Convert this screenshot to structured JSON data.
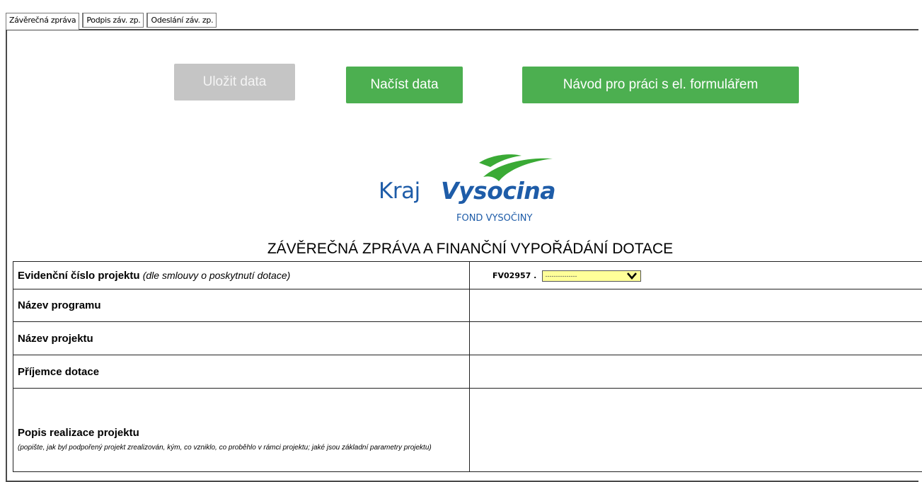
{
  "tabs": [
    {
      "label": "Závěrečná zpráva",
      "active": true
    },
    {
      "label": "Podpis záv. zp.",
      "active": false
    },
    {
      "label": "Odeslání záv. zp.",
      "active": false
    }
  ],
  "buttons": {
    "save": "Uložit data",
    "load": "Načíst data",
    "guide": "Návod pro práci s el. formulářem"
  },
  "logo": {
    "kraj": "Kraj",
    "vysocina": "Vysocina",
    "fond": "FOND VYSOČINY"
  },
  "document_title": "ZÁVĚREČNÁ ZPRÁVA A FINANČNÍ VYPOŘÁDÁNÍ DOTACE",
  "form": {
    "evidencni_label": "Evidenční číslo projektu",
    "evidencni_hint": "(dle smlouvy o poskytnutí dotace)",
    "evidencni_prefix": "FV02957 .",
    "evidencni_select_value": "---------------",
    "program_label": "Název programu",
    "projekt_label": "Název projektu",
    "prijemce_label": "Příjemce dotace",
    "popis_label": "Popis realizace projektu",
    "popis_hint": "(popište, jak byl podpořený projekt zrealizován, kým, co vzniklo, co proběhlo v rámci projektu; jaké jsou základní parametry projektu)"
  },
  "colors": {
    "accent_green": "#4caf50",
    "disabled_gray": "#c5c5c5",
    "logo_blue": "#1e5ca8",
    "logo_green": "#3aaa35",
    "select_yellow": "#ffff99"
  }
}
